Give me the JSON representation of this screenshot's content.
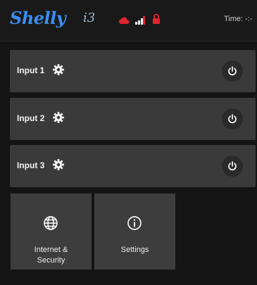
{
  "header": {
    "brand": "Shelly",
    "model": "i3",
    "time_text": "Time: -:-",
    "status_icons": [
      "cloud-icon",
      "wifi-signal-icon",
      "lock-icon"
    ],
    "status_color": "#e0262e"
  },
  "inputs": [
    {
      "label": "Input 1"
    },
    {
      "label": "Input 2"
    },
    {
      "label": "Input 3"
    }
  ],
  "tiles": [
    {
      "label": "Internet & Security",
      "icon": "globe-icon"
    },
    {
      "label": "Settings",
      "icon": "info-icon"
    }
  ],
  "colors": {
    "background": "#141414",
    "panel": "#3a3a3a",
    "brand_blue": "#3a8ef0"
  }
}
